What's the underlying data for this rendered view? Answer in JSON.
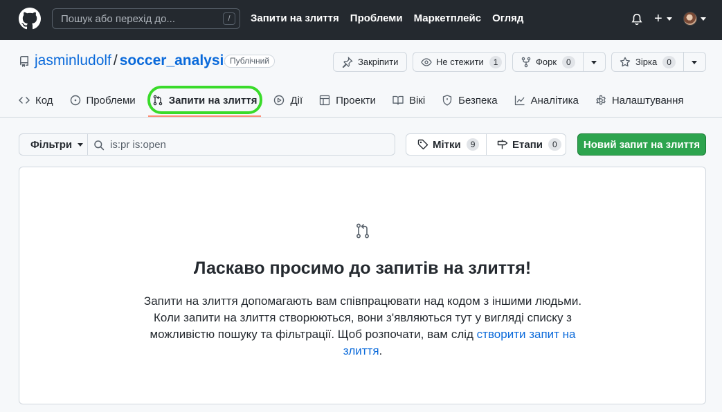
{
  "header": {
    "search_placeholder": "Пошук або перехід до...",
    "search_shortcut": "/",
    "nav": [
      "Запити на злиття",
      "Проблеми",
      "Маркетплейс",
      "Огляд"
    ],
    "plus": "+"
  },
  "repo": {
    "owner": "jasminludolf",
    "separator": "/",
    "name": "soccer_analysis",
    "visibility": "Публічний",
    "pin_label": "Закріпити",
    "watch_label": "Не стежити",
    "watch_count": "1",
    "fork_label": "Форк",
    "fork_count": "0",
    "star_label": "Зірка",
    "star_count": "0"
  },
  "tabs": [
    {
      "label": "Код",
      "icon": "code-icon"
    },
    {
      "label": "Проблеми",
      "icon": "issue-icon"
    },
    {
      "label": "Запити на злиття",
      "icon": "pull-request-icon",
      "active": true
    },
    {
      "label": "Дії",
      "icon": "play-icon"
    },
    {
      "label": "Проекти",
      "icon": "table-icon"
    },
    {
      "label": "Вікі",
      "icon": "book-icon"
    },
    {
      "label": "Безпека",
      "icon": "shield-icon"
    },
    {
      "label": "Аналітика",
      "icon": "graph-icon"
    },
    {
      "label": "Налаштування",
      "icon": "gear-icon"
    }
  ],
  "filters": {
    "label": "Фільтри",
    "query": "is:pr is:open",
    "labels_label": "Мітки",
    "labels_count": "9",
    "milestones_label": "Етапи",
    "milestones_count": "0",
    "new_pr": "Новий запит на злиття"
  },
  "blankslate": {
    "title": "Ласкаво просимо до запитів на злиття!",
    "text": "Запити на злиття допомагають вам співпрацювати над кодом з іншими людьми. Коли запити на злиття створюються, вони з'являються тут у вигляді списку з можливістю пошуку та фільтрації. Щоб розпочати, вам слід ",
    "link": "створити запит на злиття",
    "end": "."
  },
  "colors": {
    "header_bg": "#24292f",
    "link": "#0969da",
    "primary_button": "#2da44e",
    "active_tab_underline": "#fd8c73",
    "highlight_ring": "#3adb2a"
  }
}
